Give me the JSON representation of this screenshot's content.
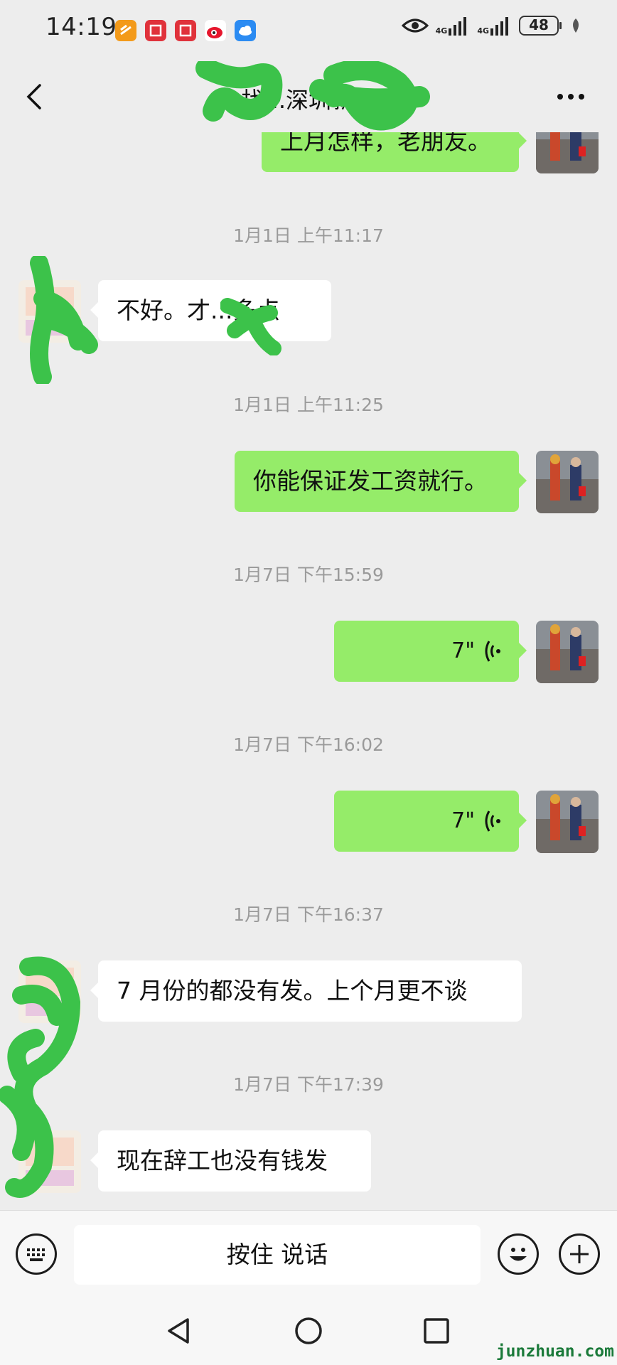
{
  "status_bar": {
    "time": "14:19",
    "network_1": "4G",
    "network_2": "4G",
    "battery": "48"
  },
  "nav": {
    "title": "找...深圳新..."
  },
  "messages": [
    {
      "kind": "out",
      "text": "上月怎样，老朋友。"
    },
    {
      "kind": "time",
      "text": "1月1日 上午11:17"
    },
    {
      "kind": "in",
      "text": "不好。才...多点"
    },
    {
      "kind": "time",
      "text": "1月1日 上午11:25"
    },
    {
      "kind": "out",
      "text": "你能保证发工资就行。"
    },
    {
      "kind": "time",
      "text": "1月7日 下午15:59"
    },
    {
      "kind": "voice",
      "duration": "7\""
    },
    {
      "kind": "time",
      "text": "1月7日 下午16:02"
    },
    {
      "kind": "voice",
      "duration": "7\""
    },
    {
      "kind": "time",
      "text": "1月7日 下午16:37"
    },
    {
      "kind": "in",
      "text": "7 月份的都没有发。上个月更不谈"
    },
    {
      "kind": "time",
      "text": "1月7日 下午17:39"
    },
    {
      "kind": "in",
      "text": "现在辞工也没有钱发"
    }
  ],
  "input_bar": {
    "hold_to_talk": "按住 说话"
  },
  "watermark": "junzhuan.com",
  "colors": {
    "background": "#ededed",
    "outgoing_bubble": "#95ec69",
    "incoming_bubble": "#ffffff",
    "timestamp_text": "#9a9a9a",
    "censor_scribble": "#3cc24a"
  },
  "icons": {
    "app_icons": [
      "orange-app-icon",
      "red-book-app-icon",
      "red-book-app-icon-2",
      "weibo-icon",
      "cloud-icon"
    ],
    "status_right": [
      "eye-icon",
      "signal-icon",
      "signal-icon-2",
      "battery-icon",
      "leaf-icon"
    ],
    "nav": [
      "back-chevron-icon",
      "more-icon"
    ],
    "input": [
      "keyboard-icon",
      "emoji-icon",
      "plus-icon"
    ],
    "system": [
      "back-triangle-icon",
      "home-circle-icon",
      "recents-square-icon"
    ]
  }
}
